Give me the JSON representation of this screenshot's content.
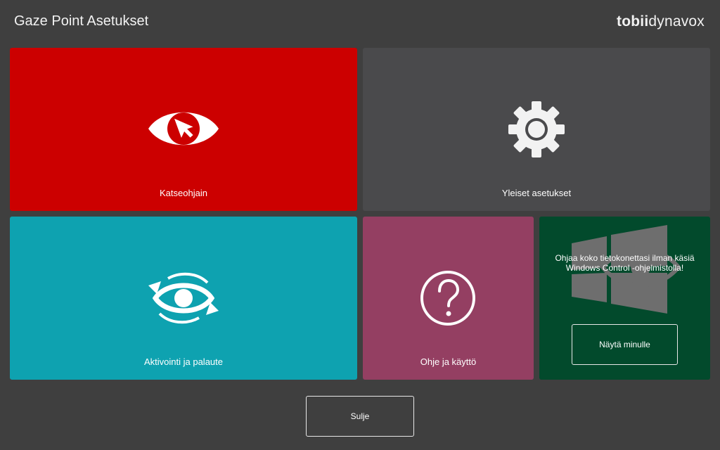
{
  "header": {
    "title": "Gaze Point Asetukset",
    "logo_bold": "tobii",
    "logo_light": "dynavox"
  },
  "tiles": {
    "gaze": {
      "label": "Katseohjain",
      "color": "#cc0000",
      "icon": "eye-cursor-icon"
    },
    "general": {
      "label": "Yleiset asetukset",
      "color": "#4a4a4c",
      "icon": "gear-icon"
    },
    "activation": {
      "label": "Aktivointi ja palaute",
      "color": "#0ea2b0",
      "icon": "eye-refresh-icon"
    },
    "help": {
      "label": "Ohje ja käyttö",
      "color": "#943f62",
      "icon": "question-icon"
    },
    "promo": {
      "color": "#024a2c",
      "text": "Ohjaa koko tietokonettasi ilman käsiä Windows Control -ohjelmistolla!",
      "button_label": "Näytä minulle",
      "icon": "windows-eye-icon"
    }
  },
  "footer": {
    "close_label": "Sulje"
  },
  "colors": {
    "background": "#3f3f3f"
  }
}
